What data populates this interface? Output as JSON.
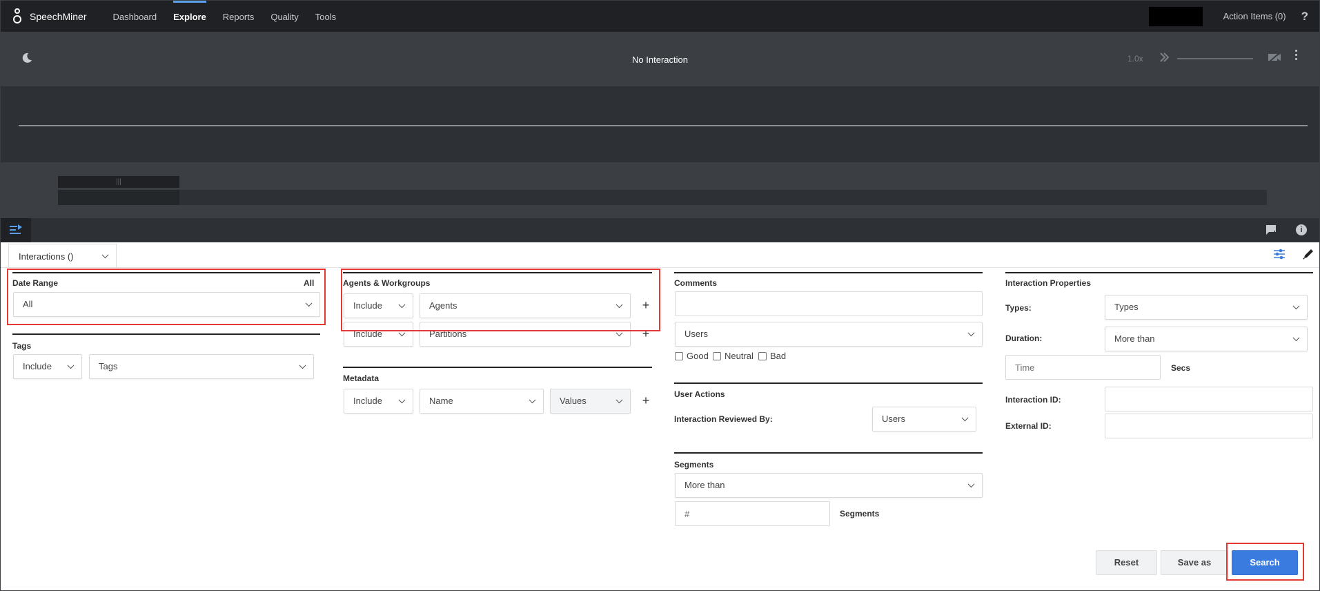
{
  "app": {
    "name": "SpeechMiner",
    "nav": [
      "Dashboard",
      "Explore",
      "Reports",
      "Quality",
      "Tools"
    ],
    "active_nav": "Explore",
    "action_items": "Action Items (0)",
    "help": "?"
  },
  "player": {
    "title": "No Interaction",
    "speed": "1.0x",
    "timeline_marker": "|||"
  },
  "tab": {
    "label": "Interactions ()"
  },
  "date_range": {
    "title": "Date Range",
    "summary": "All",
    "value": "All"
  },
  "tags": {
    "title": "Tags",
    "mode": "Include",
    "value": "Tags"
  },
  "agents": {
    "title": "Agents & Workgroups",
    "row1": {
      "mode": "Include",
      "value": "Agents"
    },
    "row2": {
      "mode": "Include",
      "value": "Partitions"
    },
    "add": "+"
  },
  "metadata": {
    "title": "Metadata",
    "mode": "Include",
    "name": "Name",
    "values": "Values",
    "add": "+"
  },
  "comments": {
    "title": "Comments",
    "users": "Users",
    "good": "Good",
    "neutral": "Neutral",
    "bad": "Bad"
  },
  "user_actions": {
    "title": "User Actions",
    "reviewed_by_label": "Interaction Reviewed By:",
    "reviewed_by_value": "Users"
  },
  "segments": {
    "title": "Segments",
    "mode": "More than",
    "count_placeholder": "#",
    "unit": "Segments"
  },
  "interaction_properties": {
    "title": "Interaction Properties",
    "types_label": "Types:",
    "types_value": "Types",
    "duration_label": "Duration:",
    "duration_value": "More than",
    "time_placeholder": "Time",
    "time_unit": "Secs",
    "interaction_id_label": "Interaction ID:",
    "external_id_label": "External ID:"
  },
  "buttons": {
    "reset": "Reset",
    "save_as": "Save as",
    "search": "Search"
  },
  "colors": {
    "accent": "#3a7be0",
    "highlight": "#e53935",
    "nav_bg": "#1f2124"
  }
}
